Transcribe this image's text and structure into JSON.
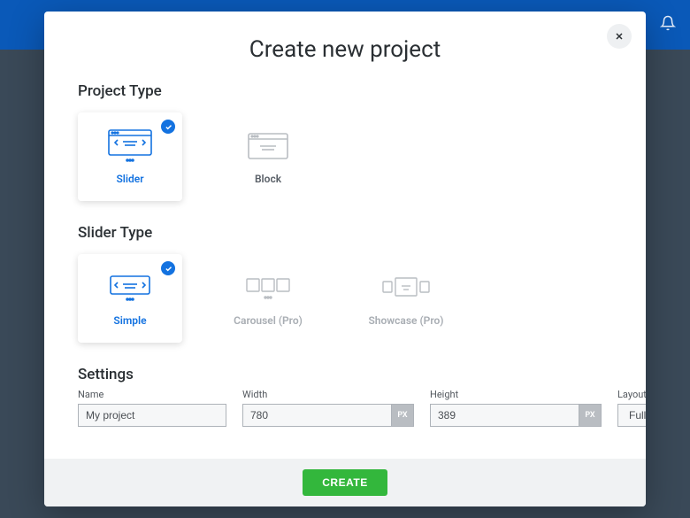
{
  "modal": {
    "title": "Create new project",
    "close_label": "Close"
  },
  "sections": {
    "project_type": {
      "heading": "Project Type",
      "options": [
        {
          "label": "Slider",
          "selected": true
        },
        {
          "label": "Block",
          "selected": false
        }
      ]
    },
    "slider_type": {
      "heading": "Slider Type",
      "options": [
        {
          "label": "Simple",
          "selected": true,
          "disabled": false
        },
        {
          "label": "Carousel (Pro)",
          "selected": false,
          "disabled": true
        },
        {
          "label": "Showcase (Pro)",
          "selected": false,
          "disabled": true
        }
      ]
    },
    "settings": {
      "heading": "Settings",
      "name": {
        "label": "Name",
        "value": "My project"
      },
      "width": {
        "label": "Width",
        "value": "780",
        "unit": "PX"
      },
      "height": {
        "label": "Height",
        "value": "389",
        "unit": "PX"
      },
      "layout": {
        "label": "Layout",
        "value": "Full width"
      }
    }
  },
  "footer": {
    "create_label": "CREATE"
  },
  "colors": {
    "accent": "#1372e0",
    "success": "#33b73c",
    "topbar": "#0a59b8"
  }
}
